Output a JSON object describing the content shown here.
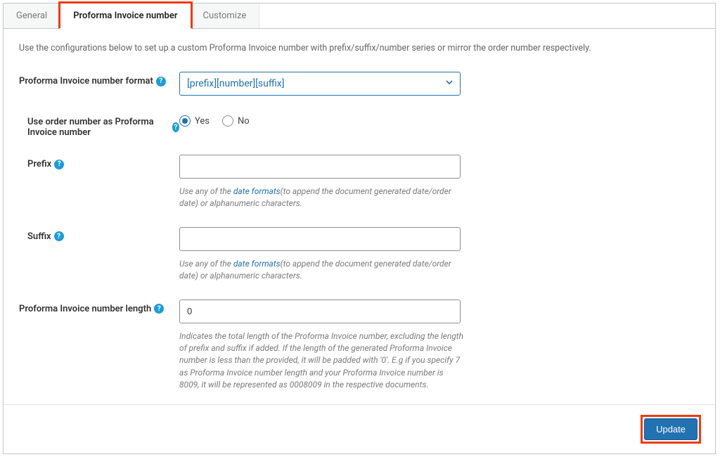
{
  "tabs": {
    "general": "General",
    "proforma": "Proforma Invoice number",
    "customize": "Customize"
  },
  "intro": "Use the configurations below to set up a custom Proforma Invoice number with prefix/suffix/number series or mirror the order number respectively.",
  "labels": {
    "format": "Proforma Invoice number format",
    "use_order": "Use order number as Proforma Invoice number",
    "prefix": "Prefix",
    "suffix": "Suffix",
    "length": "Proforma Invoice number length"
  },
  "format_select": "[prefix][number][suffix]",
  "radio": {
    "yes": "Yes",
    "no": "No"
  },
  "hints": {
    "prefix_pre": "Use any of the ",
    "prefix_link": "date formats",
    "prefix_post": "(to append the document generated date/order date) or alphanumeric characters.",
    "suffix_pre": "Use any of the ",
    "suffix_link": "date formats",
    "suffix_post": "(to append the document generated date/order date) or alphanumeric characters.",
    "length": "Indicates the total length of the Proforma Invoice number, excluding the length of prefix and suffix if added. If the length of the generated Proforma Invoice number is less than the provided, it will be padded with '0'. E.g if you specify 7 as Proforma Invoice number length and your Proforma Invoice number is 8009, it will be represented as 0008009 in the respective documents."
  },
  "values": {
    "prefix": "",
    "suffix": "",
    "length": "0"
  },
  "buttons": {
    "update": "Update"
  },
  "help_glyph": "?"
}
